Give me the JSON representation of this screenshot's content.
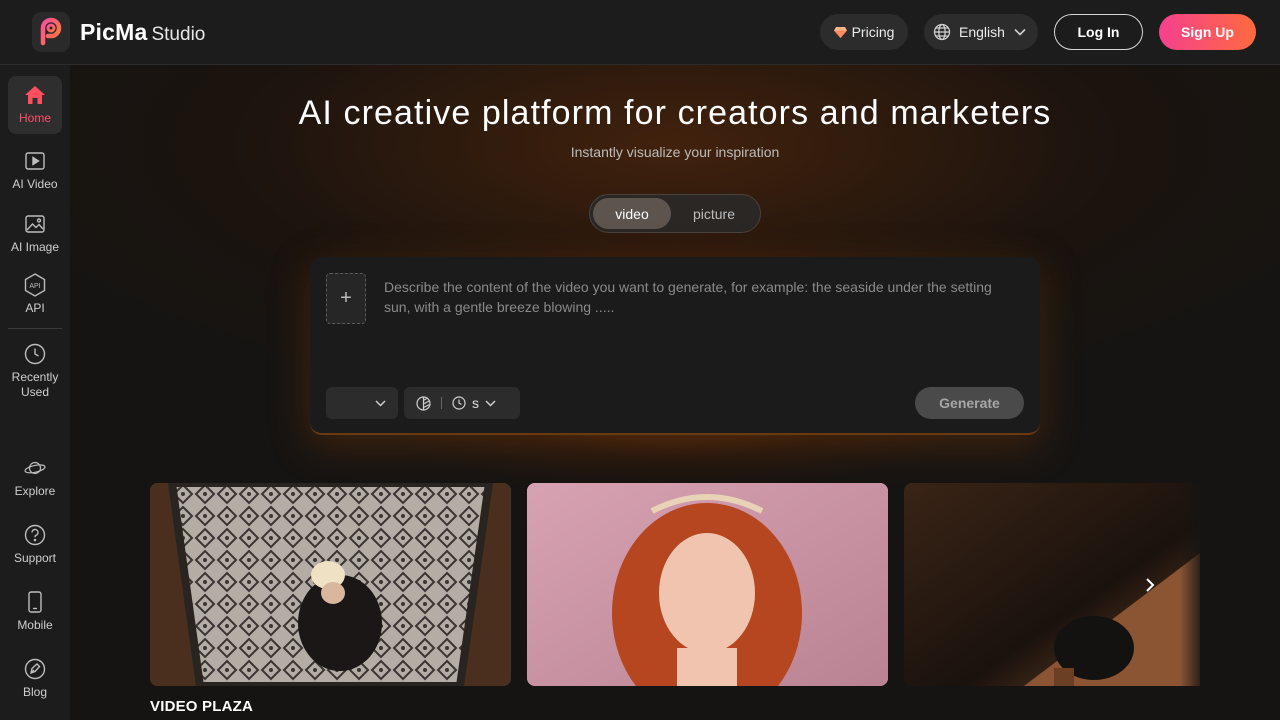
{
  "header": {
    "brand_main": "PicMa",
    "brand_sub": "Studio",
    "pricing_label": "Pricing",
    "language_label": "English",
    "login_label": "Log In",
    "signup_label": "Sign Up"
  },
  "sidebar": {
    "items": [
      {
        "label": "Home",
        "icon": "home-icon",
        "active": true
      },
      {
        "label": "AI Video",
        "icon": "video-icon"
      },
      {
        "label": "AI Image",
        "icon": "image-icon"
      },
      {
        "label": "API",
        "icon": "api-icon"
      },
      {
        "label": "Recently Used",
        "icon": "clock-icon"
      },
      {
        "label": "Explore",
        "icon": "planet-icon"
      },
      {
        "label": "Support",
        "icon": "question-icon"
      },
      {
        "label": "Mobile",
        "icon": "mobile-icon"
      },
      {
        "label": "Blog",
        "icon": "blog-icon"
      }
    ]
  },
  "hero": {
    "title": "AI creative platform for creators and marketers",
    "subtitle": "Instantly visualize your inspiration"
  },
  "mode_toggle": {
    "options": [
      "video",
      "picture"
    ],
    "selected": "video"
  },
  "prompt": {
    "upload_icon": "+",
    "placeholder": "Describe the content of the video you want to generate, for example: the seaside under the setting sun, with a gentle breeze blowing .....",
    "value": "",
    "model_value": "",
    "duration_value": "s",
    "generate_label": "Generate"
  },
  "gallery": {
    "section_title": "VIDEO PLAZA"
  },
  "colors": {
    "accent": "#ff4f6b",
    "signup_gradient_start": "#f5408f",
    "signup_gradient_end": "#ff6a3d",
    "background": "#141414"
  }
}
